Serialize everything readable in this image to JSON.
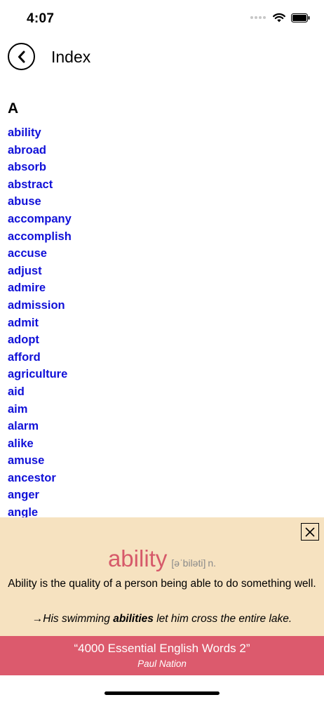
{
  "status_bar": {
    "time": "4:07"
  },
  "nav": {
    "title": "Index",
    "back_icon": "chevron-left-icon"
  },
  "index": {
    "section_letter": "A",
    "words": [
      "ability",
      "abroad",
      "absorb",
      "abstract",
      "abuse",
      "accompany",
      "accomplish",
      "accuse",
      "adjust",
      "admire",
      "admission",
      "admit",
      "adopt",
      "afford",
      "agriculture",
      "aid",
      "aim",
      "alarm",
      "alike",
      "amuse",
      "ancestor",
      "anger",
      "angle"
    ]
  },
  "definition_panel": {
    "word": "ability",
    "pronunciation": "[əˈbiləti]",
    "part_of_speech": "n.",
    "definition": "Ability is the quality of a person being able to do something well.",
    "example_prefix": "→His swimming ",
    "example_highlight": "abilities",
    "example_suffix": " let him cross the entire lake.",
    "close_icon": "close-icon"
  },
  "book": {
    "title": "“4000 Essential English Words 2”",
    "author": "Paul Nation"
  },
  "colors": {
    "link": "#1010d8",
    "panel_bg": "#f6e2c0",
    "headword": "#d65a6a",
    "banner_bg": "#dc5a6d"
  }
}
